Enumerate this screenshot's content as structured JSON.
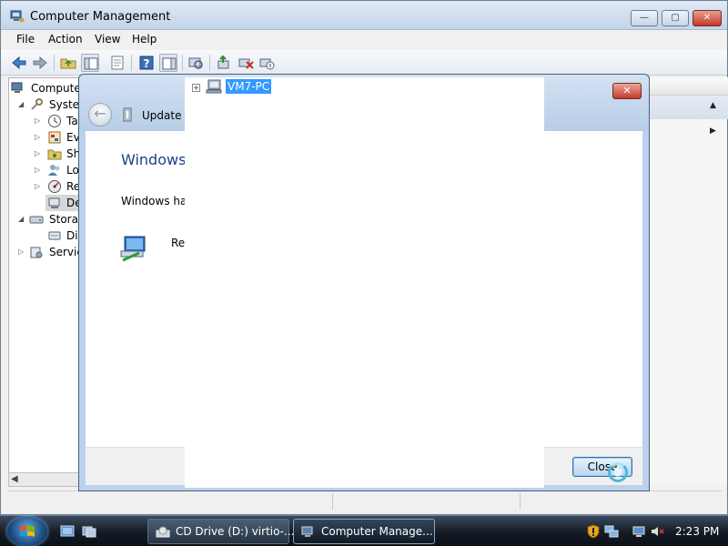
{
  "window": {
    "title": "Computer Management",
    "menu": [
      "File",
      "Action",
      "View",
      "Help"
    ]
  },
  "tree": {
    "items": [
      {
        "label": "Computer",
        "indent": 0,
        "expander": ""
      },
      {
        "label": "System",
        "indent": 1,
        "expander": "◢"
      },
      {
        "label": "Ta",
        "indent": 2,
        "expander": "▷"
      },
      {
        "label": "Eve",
        "indent": 2,
        "expander": "▷"
      },
      {
        "label": "Sha",
        "indent": 2,
        "expander": "▷"
      },
      {
        "label": "Loc",
        "indent": 2,
        "expander": "▷"
      },
      {
        "label": "Re",
        "indent": 2,
        "expander": "▷"
      },
      {
        "label": "De",
        "indent": 2,
        "expander": ""
      },
      {
        "label": "Storag",
        "indent": 1,
        "expander": "◢"
      },
      {
        "label": "Dis",
        "indent": 2,
        "expander": ""
      },
      {
        "label": "Service",
        "indent": 1,
        "expander": "▷"
      }
    ]
  },
  "dialog": {
    "title": "Update D",
    "heading": "Windows I",
    "message": "Windows has",
    "file_label": "Re",
    "close_button": "Close"
  },
  "popup": {
    "expander": "+",
    "node_label": "VM7-PC"
  },
  "taskbar": {
    "tasks": [
      {
        "label": "CD Drive (D:) virtio-...",
        "active": false
      },
      {
        "label": "Computer Manage...",
        "active": true
      }
    ],
    "clock": "2:23 PM"
  },
  "colors": {
    "selection": "#3399ff",
    "dialog_heading": "#1e3f8a",
    "close_caption": "#c4392b"
  }
}
